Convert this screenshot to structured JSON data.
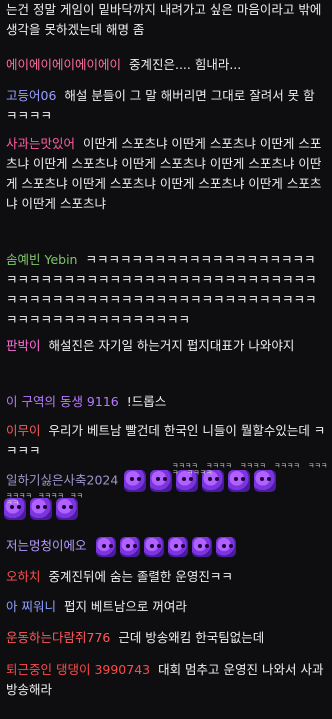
{
  "messages": [
    {
      "id": "m0",
      "name": "",
      "text": "는건 정말 게임이 밑바닥까지 내려가고 싶은 마음이라고 밖에 생각을 못하겠는데 해명 좀",
      "color": "#efeff1"
    },
    {
      "id": "m1",
      "name": "에이에이에이에이에이",
      "text": "중계진은.... 힘내라...",
      "color": "#ff6b9e"
    },
    {
      "id": "m2",
      "name": "고등어06",
      "text": "해설 분들이 그 말 해버리면 그대로 잘려서 못 함 ㅋㅋㅋㅋ",
      "color": "#9aa0ff"
    },
    {
      "id": "m3",
      "name": "사과는맛있어",
      "text": "이딴게 스포츠냐 이딴게 스포츠냐 이딴게 스포츠냐 이딴게 스포츠냐 이딴게 스포츠냐 이딴게 스포츠냐 이딴게 스포츠냐 이딴게 스포츠냐 이딴게 스포츠냐 이딴게 스포츠냐 이딴게 스포츠냐",
      "color": "#ff5fa2"
    },
    {
      "id": "m4",
      "name": "솜예빈 Yebin",
      "text": "ㅋㅋㅋㅋㅋㅋㅋㅋㅋㅋㅋㅋㅋㅋㅋㅋㅋㅋㅋㅋㅋㅋㅋㅋㅋㅋㅋㅋㅋㅋㅋㅋㅋㅋㅋㅋㅋㅋㅋㅋㅋㅋㅋㅋㅋㅋㅋㅋㅋㅋㅋㅋㅋㅋㅋㅋㅋㅋㅋㅋㅋㅋㅋㅋㅋㅋㅋㅋㅋㅋㅋㅋㅋㅋㅋㅋㅋㅋㅋㅋㅋㅋㅋㅋㅋㅋㅋㅋㅋㅋ",
      "color": "#7ec66b"
    },
    {
      "id": "m5",
      "name": "판박이",
      "text": "해설진은 자기일 하는거지 펍지대표가 나와야지",
      "color": "#ff6fd8"
    },
    {
      "id": "m6",
      "name": "이 구역의 동생 9116",
      "text": "!드롭스",
      "color": "#b77bff"
    },
    {
      "id": "m7",
      "name": "이무이",
      "text": "우리가 베트남 빨건데 한국인 니들이 뭘할수있는데 ㅋㅋㅋㅋ",
      "color": "#ff5a5a"
    },
    {
      "id": "m8",
      "name": "일하기싫은사축2024",
      "text": "",
      "color": "#9d96c8",
      "emotes": 6,
      "emote_labels": [
        "ㅋㅋㅋㅋ",
        "ㅋㅋㅋㅋ",
        "ㅋㅋㅋㅋ",
        "ㅋㅋㅋㅋ",
        "ㅋㅋㅋㅋ",
        "ㅋㅋㅋㅋ",
        "ㅋㅋㅋㅋ",
        "ㅋㅋㅋㅋ",
        "ㅋㅋㅋㅋ"
      ],
      "emotes_line2": 3
    },
    {
      "id": "m9",
      "name": "저는멍청이에오",
      "text": "",
      "color": "#b59bff",
      "emotes": 6
    },
    {
      "id": "m10",
      "name": "오하치",
      "text": "중계진뒤에 숨는 졸렬한 운영진ㅋㅋ",
      "color": "#ff4f4f"
    },
    {
      "id": "m11",
      "name": "아 찌워니",
      "text": "펍지 베트남으로 꺼여라",
      "color": "#8fa0ff"
    },
    {
      "id": "m12",
      "name": "운동하는다람쥐776",
      "text": "근데 방송왜킴 한국팀없는데",
      "color": "#ff5a5a"
    },
    {
      "id": "m13",
      "name": "퇴근중인 댕댕이 3990743",
      "text": "대회 멈추고 운영진 나와서 사과 방송해라",
      "color": "#ff4a4a"
    }
  ]
}
